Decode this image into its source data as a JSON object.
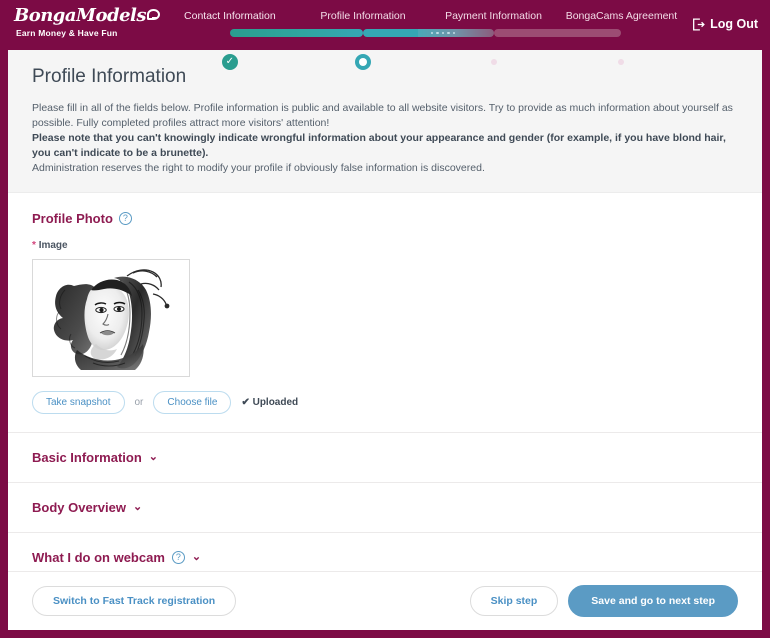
{
  "brand": {
    "wordmark": "BongaModels",
    "tagline": "Earn Money & Have Fun",
    "frame_color": "#7c0b45"
  },
  "header": {
    "logout_label": "Log Out",
    "steps": [
      {
        "label": "Contact Information",
        "state": "done"
      },
      {
        "label": "Profile Information",
        "state": "current"
      },
      {
        "label": "Payment Information",
        "state": "pending"
      },
      {
        "label": "BongaCams Agreement",
        "state": "pending"
      }
    ],
    "colors": {
      "done": "#2a9d8f",
      "current": "#35a7b4",
      "pending": "#9c4c73"
    }
  },
  "intro": {
    "title": "Profile Information",
    "paragraphs": [
      "Please fill in all of the fields below. Profile information is public and available to all website visitors. Try to provide as much information about yourself as possible. Fully completed profiles attract more visitors' attention!",
      "Please note that you can't knowingly indicate wrongful information about your appearance and gender (for example, if you have blond hair, you can't indicate to be a brunette).",
      "Administration reserves the right to modify your profile if obviously false information is discovered."
    ]
  },
  "photo_section": {
    "title": "Profile Photo",
    "help_glyph": "?",
    "field_required_marker": "*",
    "field_label": "Image",
    "image_alt": "pencil-sketch-portrait-of-woman",
    "take_snapshot_label": "Take snapshot",
    "or_label": "or",
    "choose_file_label": "Choose file",
    "uploaded_label": "✔ Uploaded"
  },
  "accordion": [
    {
      "title": "Basic Information",
      "has_help": false,
      "chevron": "⌄"
    },
    {
      "title": "Body Overview",
      "has_help": false,
      "chevron": "⌄"
    },
    {
      "title": "What I do on webcam",
      "has_help": true,
      "chevron": "⌄"
    }
  ],
  "footer": {
    "fast_track_label": "Switch to Fast Track registration",
    "skip_label": "Skip step",
    "save_label": "Save and go to next step",
    "primary_color": "#5b9bc4"
  }
}
